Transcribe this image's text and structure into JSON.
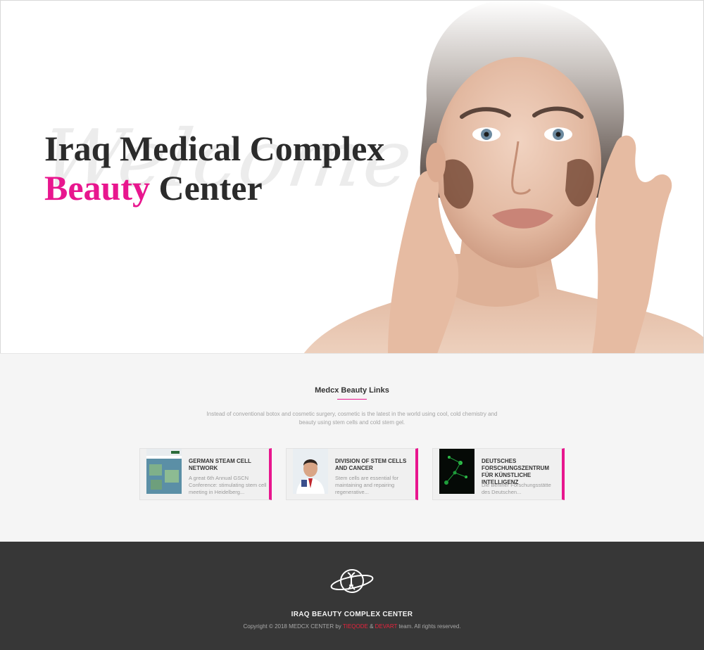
{
  "hero": {
    "script_word": "Welcome",
    "title_line1": "Iraq Medical Complex",
    "title_accent": "Beauty",
    "title_rest": " Center"
  },
  "links_section": {
    "title": "Medcx Beauty Links",
    "description": "Instead of conventional botox and cosmetic surgery, cosmetic is the latest in the world using cool, cold chemistry and beauty using stem cells and cold stem gel.",
    "cards": [
      {
        "title": "GERMAN STEAM CELL NETWORK",
        "text": "A great 6th Annual GSCN Conference: stimulating stem cell meeting in Heidelberg..."
      },
      {
        "title": "DIVISION OF STEM CELLS AND CANCER",
        "text": "Stem cells are essential for maintaining and repairing regenerative..."
      },
      {
        "title": "DEUTSCHES FORSCHUNGSZENTRUM FÜR KÜNSTLICHE INTELLIGENZ",
        "text": "Die Berliner Forschungsstätte des Deutschen..."
      }
    ]
  },
  "footer": {
    "name": "IRAQ BEAUTY COMPLEX CENTER",
    "copy_prefix": "Copyright © 2018 MEDCX CENTER by ",
    "brand1": "TIEQODE",
    "amp": " & ",
    "brand2": "DEVART",
    "copy_suffix": " team. All rights reserved."
  },
  "colors": {
    "accent": "#e8168e",
    "footer_bg": "#373737",
    "section_bg": "#f5f5f5",
    "brand_red": "#e8233c"
  },
  "icons": {
    "footer_logo": "globe-dna-icon"
  }
}
